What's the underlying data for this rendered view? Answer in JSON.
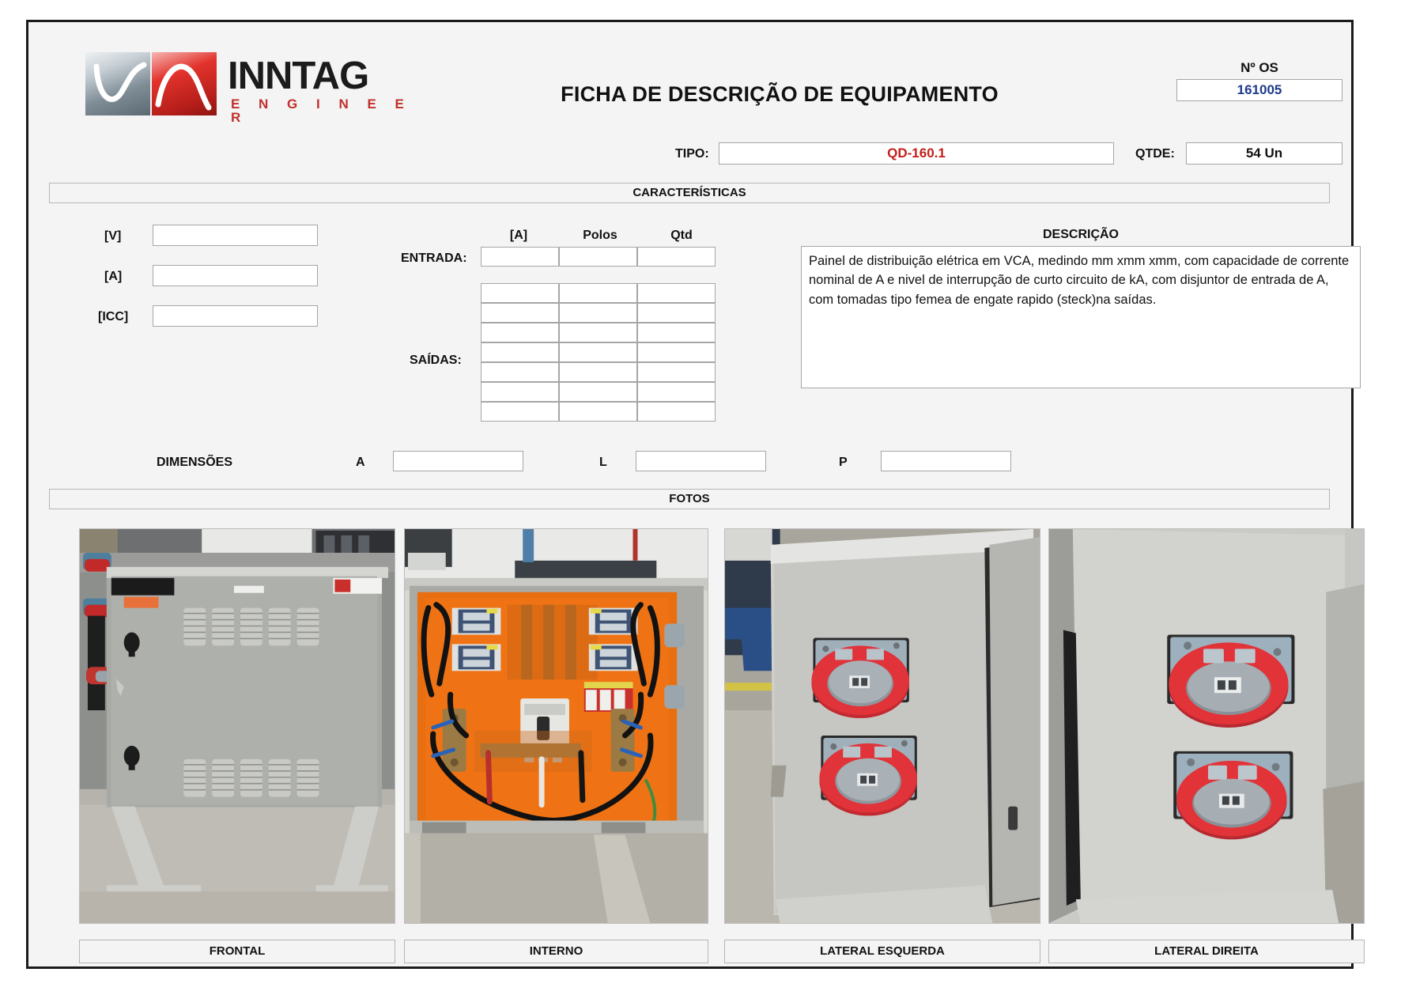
{
  "brand": {
    "name": "INNTAG",
    "tagline": "E N G I N E E R",
    "logo_gray_hex": "#7f8d97",
    "logo_red_hex": "#e2332c",
    "tagline_hex": "#c0302b"
  },
  "header": {
    "title": "FICHA DE DESCRIÇÃO DE EQUIPAMENTO",
    "os_label": "Nº OS",
    "os_value": "161005",
    "os_value_hex": "#1f3b8c",
    "tipo_label": "TIPO:",
    "tipo_value": "QD-160.1",
    "tipo_value_hex": "#c1201a",
    "qtde_label": "QTDE:",
    "qtde_value": "54 Un"
  },
  "sections": {
    "caracteristicas": "CARACTERÍSTICAS",
    "fotos": "FOTOS"
  },
  "ratings": {
    "v_label": "[V]",
    "v_value": "",
    "a_label": "[A]",
    "a_value": "",
    "icc_label": "[ICC]",
    "icc_value": ""
  },
  "circuits": {
    "columns": [
      "[A]",
      "Polos",
      "Qtd"
    ],
    "entrada_label": "ENTRADA:",
    "entrada_row": [
      "",
      "",
      ""
    ],
    "saidas_label": "SAÍDAS:",
    "saidas_rows": [
      [
        "",
        "",
        ""
      ],
      [
        "",
        "",
        ""
      ],
      [
        "",
        "",
        ""
      ],
      [
        "",
        "",
        ""
      ],
      [
        "",
        "",
        ""
      ],
      [
        "",
        "",
        ""
      ],
      [
        "",
        "",
        ""
      ]
    ]
  },
  "descricao": {
    "title": "DESCRIÇÃO",
    "text": "Painel de distribuição elétrica em VCA, medindo mm xmm xmm, com capacidade de corrente nominal de A e nivel de interrupção de curto circuito de kA, com disjuntor de entrada de A, com tomadas tipo femea de engate rapido (steck)na saídas."
  },
  "dimensoes": {
    "label": "DIMENSÕES",
    "a_label": "A",
    "a_value": "",
    "l_label": "L",
    "l_value": "",
    "p_label": "P",
    "p_value": ""
  },
  "photos": [
    {
      "caption": "FRONTAL",
      "alt": "photo-cabinet-front"
    },
    {
      "caption": "INTERNO",
      "alt": "photo-cabinet-interior"
    },
    {
      "caption": "LATERAL ESQUERDA",
      "alt": "photo-cabinet-left-side"
    },
    {
      "caption": "LATERAL DIREITA",
      "alt": "photo-cabinet-right-side"
    }
  ]
}
